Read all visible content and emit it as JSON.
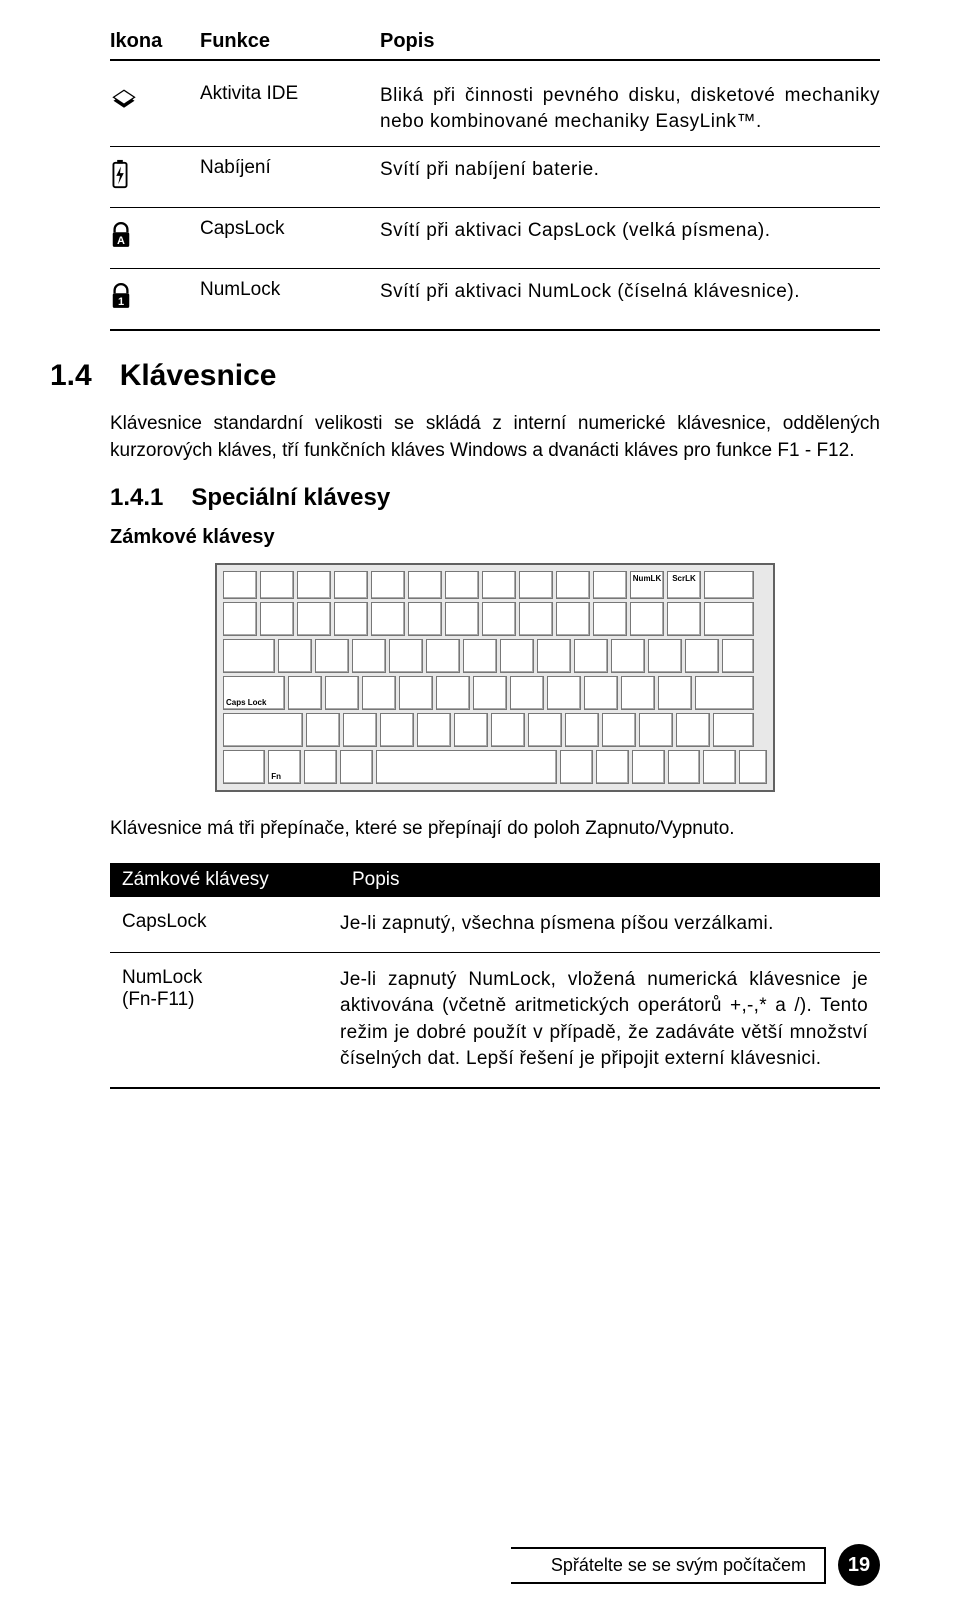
{
  "table1": {
    "headers": {
      "icon": "Ikona",
      "func": "Funkce",
      "desc": "Popis"
    },
    "rows": [
      {
        "icon": "ide",
        "func": "Aktivita IDE",
        "desc": "Bliká při činnosti pevného disku, disketové mechaniky nebo kombinované mechaniky EasyLink™."
      },
      {
        "icon": "bat",
        "func": "Nabíjení",
        "desc": "Svítí při nabíjení baterie."
      },
      {
        "icon": "caps",
        "func": "CapsLock",
        "desc": "Svítí při aktivaci CapsLock (velká písmena)."
      },
      {
        "icon": "num",
        "func": "NumLock",
        "desc": "Svítí při aktivaci NumLock (číselná klávesnice)."
      }
    ]
  },
  "section": {
    "num": "1.4",
    "title": "Klávesnice"
  },
  "para1": "Klávesnice standardní velikosti se skládá z interní numerické klávesnice, oddělených kurzorových kláves, tří funkčních kláves Windows a dvanácti kláves pro funkce F1 - F12.",
  "sub": {
    "num": "1.4.1",
    "title": "Speciální klávesy"
  },
  "subhead": "Zámkové klávesy",
  "kbd_labels": {
    "numlk": "NumLK",
    "scrlk": "ScrLK",
    "caps": "Caps Lock",
    "fn": "Fn"
  },
  "para2": "Klávesnice má tři přepínače, které se přepínají do poloh Zapnuto/Vypnuto.",
  "lock_table": {
    "headers": {
      "c1": "Zámkové klávesy",
      "c2": "Popis"
    },
    "rows": [
      {
        "c1a": "CapsLock",
        "c1b": "",
        "c2": "Je-li zapnutý, všechna písmena píšou verzálkami."
      },
      {
        "c1a": "NumLock",
        "c1b": "(Fn-F11)",
        "c2": "Je-li zapnutý NumLock, vložená numerická klávesnice je aktivována (včetně aritmetických operátorů +,-,* a /). Tento režim je dobré použít v případě, že zadáváte větší množství číselných dat. Lepší řešení je připojit externí klávesnici."
      }
    ]
  },
  "footer": "Spřátelte se se svým počítačem",
  "page": "19"
}
